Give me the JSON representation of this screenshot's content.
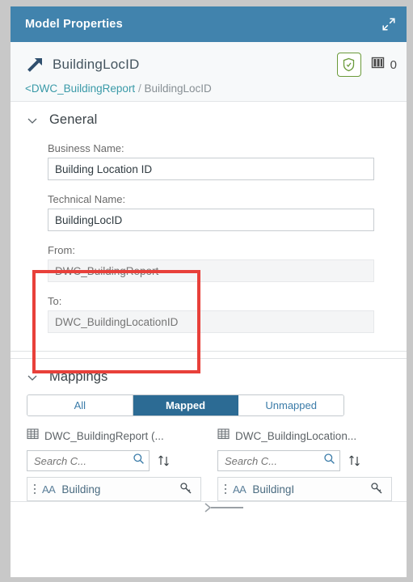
{
  "window": {
    "title": "Model Properties",
    "expand_icon": "expand-icon",
    "header_color": "#4183ad"
  },
  "object_header": {
    "icon": "association-arrow-icon",
    "title": "BuildingLocID",
    "shield_icon": "shield-check-icon",
    "shield_border_color": "#6a9a3a",
    "grid_icon": "table-grid-icon",
    "count": "0",
    "breadcrumb": {
      "link": "<DWC_BuildingReport",
      "separator": "/",
      "current": "BuildingLocID",
      "link_color": "#3a9aa8"
    }
  },
  "general_section": {
    "chevron_icon": "chevron-down-icon",
    "title": "General",
    "fields": [
      {
        "label": "Business Name:",
        "value": "Building Location ID",
        "placeholder": "",
        "readonly": false
      },
      {
        "label": "Technical Name:",
        "value": "BuildingLocID",
        "placeholder": "",
        "readonly": false
      },
      {
        "label": "From:",
        "value": "DWC_BuildingReport",
        "placeholder": "DWC_BuildingReport",
        "readonly": true
      },
      {
        "label": "To:",
        "value": "DWC_BuildingLocationID",
        "placeholder": "DWC_BuildingLocationID",
        "readonly": true
      }
    ]
  },
  "annotation": {
    "highlight_color": "#e8403a"
  },
  "mappings_section": {
    "chevron_icon": "chevron-down-icon",
    "title": "Mappings",
    "filter_tabs": [
      {
        "label": "All",
        "active": false
      },
      {
        "label": "Mapped",
        "active": true
      },
      {
        "label": "Unmapped",
        "active": false
      }
    ],
    "active_tab_color": "#2c6b94",
    "columns": [
      {
        "icon": "table-columns-icon",
        "header": "DWC_BuildingReport (...",
        "search_placeholder": "Search C...",
        "search_value": "",
        "search_icon": "search-icon",
        "sort_icon": "sort-ascending-descending-icon",
        "items": [
          {
            "drag_icon": "drag-handle-dots-icon",
            "type_icon": "AA",
            "label": "Building",
            "key_icon": "key-icon"
          }
        ]
      },
      {
        "icon": "table-columns-icon",
        "header": "DWC_BuildingLocation...",
        "search_placeholder": "Search C...",
        "search_value": "",
        "search_icon": "search-icon",
        "sort_icon": "sort-ascending-descending-icon",
        "items": [
          {
            "drag_icon": "drag-handle-dots-icon",
            "type_icon": "AA",
            "label": "BuildingI",
            "key_icon": "key-icon"
          }
        ]
      }
    ],
    "connector_icon": "mapping-connector-line"
  }
}
